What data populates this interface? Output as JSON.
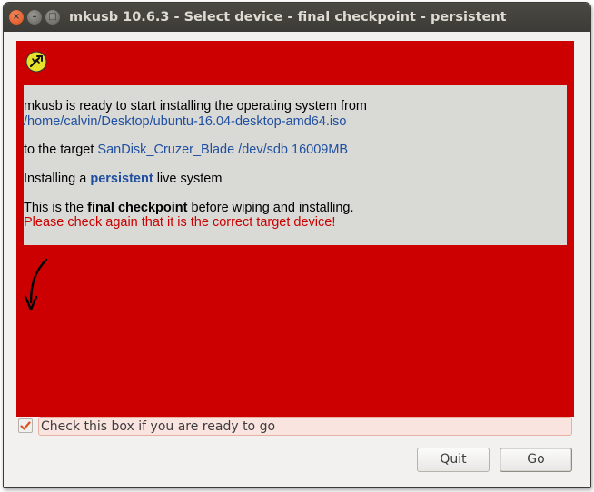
{
  "window": {
    "title": "mkusb 10.6.3 - Select device - final checkpoint - persistent",
    "controls": {
      "close": "×",
      "minimize": "–",
      "maximize": "□"
    }
  },
  "info": {
    "line1": "mkusb is ready to start installing the operating system from",
    "iso_path": "/home/calvin/Desktop/ubuntu-16.04-desktop-amd64.iso",
    "target_prefix": "to the target ",
    "target_device": "SanDisk_Cruzer_Blade /dev/sdb 16009MB",
    "install_prefix": "Installing a ",
    "install_mode": "persistent",
    "install_suffix": " live system",
    "final_prefix": "This is the ",
    "final_bold": "final checkpoint",
    "final_suffix": " before wiping and installing.",
    "warning": "Please check again that it is the correct target device!"
  },
  "confirm": {
    "label": "Check this box if you are ready to go",
    "checked": true
  },
  "buttons": {
    "quit": "Quit",
    "go": "Go"
  },
  "colors": {
    "panel": "#cc0000",
    "info_background": "#d9d9d5",
    "link": "#1f4fa0",
    "warning": "#cc0000",
    "checkbox_accent": "#e0501f"
  },
  "icons": {
    "app": "usb-icon",
    "hint": "curved-arrow-down-icon"
  }
}
